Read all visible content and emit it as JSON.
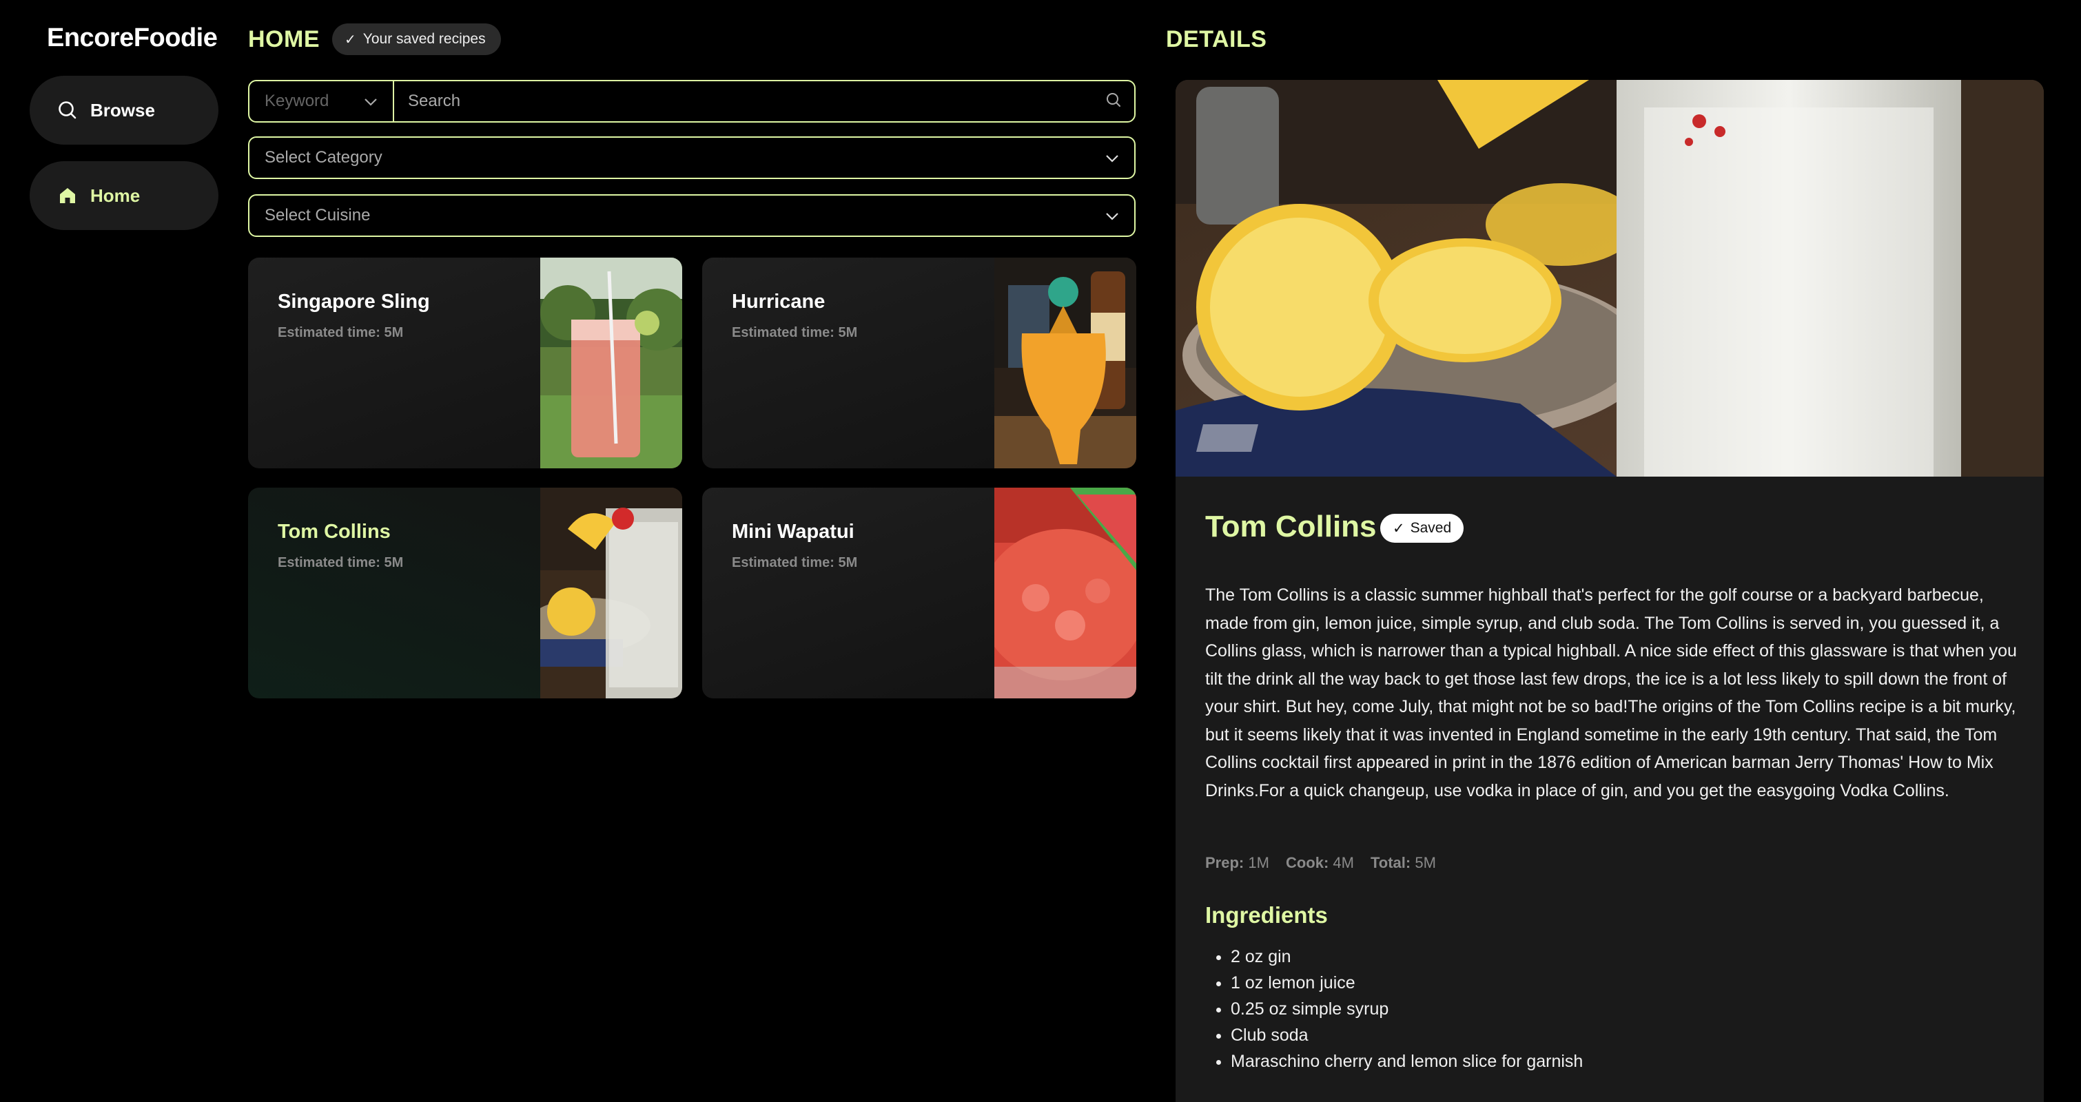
{
  "app": {
    "brand": "EncoreFoodie"
  },
  "sidebar": {
    "items": [
      {
        "label": "Browse",
        "icon": "search-icon"
      },
      {
        "label": "Home",
        "icon": "home-icon",
        "active": true
      }
    ]
  },
  "home": {
    "title": "HOME",
    "saved_pill": "Your saved recipes",
    "keyword_select": "Keyword",
    "search_placeholder": "Search",
    "category_select": "Select Category",
    "cuisine_select": "Select Cuisine",
    "recipes": [
      {
        "title": "Singapore Sling",
        "time": "Estimated time: 5M"
      },
      {
        "title": "Hurricane",
        "time": "Estimated time: 5M"
      },
      {
        "title": "Tom Collins",
        "time": "Estimated time: 5M",
        "selected": true
      },
      {
        "title": "Mini Wapatui",
        "time": "Estimated time: 5M"
      }
    ]
  },
  "details": {
    "section_title": "DETAILS",
    "title": "Tom Collins",
    "saved_badge": "Saved",
    "description": "The Tom Collins is a classic summer highball that's perfect for the golf course or a backyard barbecue, made from gin, lemon juice, simple syrup, and club soda. The Tom Collins is served in, you guessed it, a Collins glass, which is narrower than a typical highball. A nice side effect of this glassware is that when you tilt the drink all the way back to get those last few drops, the ice is a lot less likely to spill down the front of your shirt. But hey, come July, that might not be so bad!The origins of the Tom Collins recipe is a bit murky, but it seems likely that it was invented in England sometime in the early 19th century. That said, the Tom Collins cocktail first appeared in print in the 1876 edition of American barman Jerry Thomas' How to Mix Drinks.For a quick changeup, use vodka in place of gin, and you get the easygoing Vodka Collins.",
    "prep_label": "Prep:",
    "prep_value": "1M",
    "cook_label": "Cook:",
    "cook_value": "4M",
    "total_label": "Total:",
    "total_value": "5M",
    "ingredients_title": "Ingredients",
    "ingredients": [
      "2 oz gin",
      "1 oz lemon juice",
      "0.25 oz simple syrup",
      "Club soda",
      "Maraschino cherry and lemon slice for garnish"
    ]
  },
  "colors": {
    "accent": "#dff7a4",
    "background": "#000000",
    "card": "#1a1a1a"
  }
}
